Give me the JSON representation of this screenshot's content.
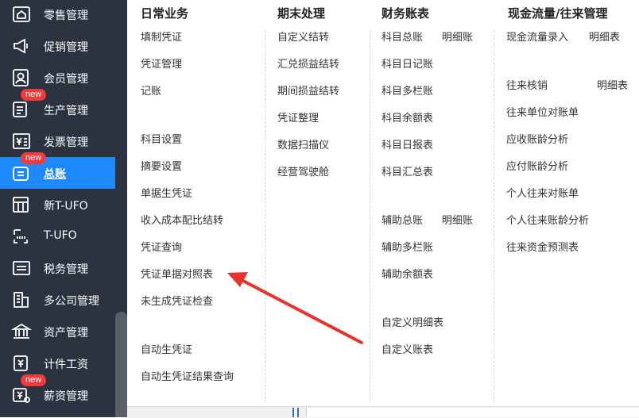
{
  "sidebar": {
    "items": [
      {
        "label": "零售管理",
        "icon": "retail-icon"
      },
      {
        "label": "促销管理",
        "icon": "megaphone-icon"
      },
      {
        "label": "会员管理",
        "icon": "member-icon"
      },
      {
        "label": "生产管理",
        "icon": "production-icon",
        "badge": "new"
      },
      {
        "label": "发票管理",
        "icon": "invoice-icon"
      },
      {
        "label": "总账",
        "icon": "ledger-icon",
        "badge": "new",
        "active": true
      },
      {
        "label": "新T-UFO",
        "icon": "new-tufo-icon"
      },
      {
        "label": "T-UFO",
        "icon": "tufo-icon"
      },
      {
        "label": "税务管理",
        "icon": "tax-icon"
      },
      {
        "label": "多公司管理",
        "icon": "multi-company-icon"
      },
      {
        "label": "资产管理",
        "icon": "asset-icon"
      },
      {
        "label": "计件工资",
        "icon": "piece-wage-icon"
      },
      {
        "label": "薪资管理",
        "icon": "salary-icon",
        "badge": "new"
      }
    ]
  },
  "menu": {
    "daily": {
      "title": "日常业务",
      "items": [
        "填制凭证",
        "凭证管理",
        "记账",
        "科目设置",
        "摘要设置",
        "单据生凭证",
        "收入成本配比结转",
        "凭证查询",
        "凭证单据对照表",
        "未生成凭证检查",
        "自动生凭证",
        "自动生凭证结果查询"
      ]
    },
    "period_end": {
      "title": "期末处理",
      "items": [
        "自定义结转",
        "汇兑损益结转",
        "期间损益结转",
        "凭证整理",
        "数据扫描仪",
        "经营驾驶舱"
      ]
    },
    "reports": {
      "title": "财务账表",
      "items": [
        "科目总账",
        "明细账",
        "科目日记账",
        "科目多栏账",
        "科目余额表",
        "科目日报表",
        "科目汇总表",
        "辅助总账",
        "明细账",
        "辅助多栏账",
        "辅助余额表",
        "自定义明细表",
        "自定义账表"
      ]
    },
    "cashflow": {
      "title": "现金流量/往来管理",
      "items": [
        "现金流量录入",
        "明细表",
        "往来核销",
        "明细表",
        "往来单位对账单",
        "应收账龄分析",
        "应付账龄分析",
        "个人往来对账单",
        "个人往来账龄分析",
        "往来资金预测表"
      ]
    }
  },
  "annotation": {
    "color": "#e8322e",
    "target": "凭证单据对照表"
  },
  "colors": {
    "sidebar_bg": "#2b3341",
    "active_bg": "#1e88ff",
    "badge": "#f23a3a"
  }
}
